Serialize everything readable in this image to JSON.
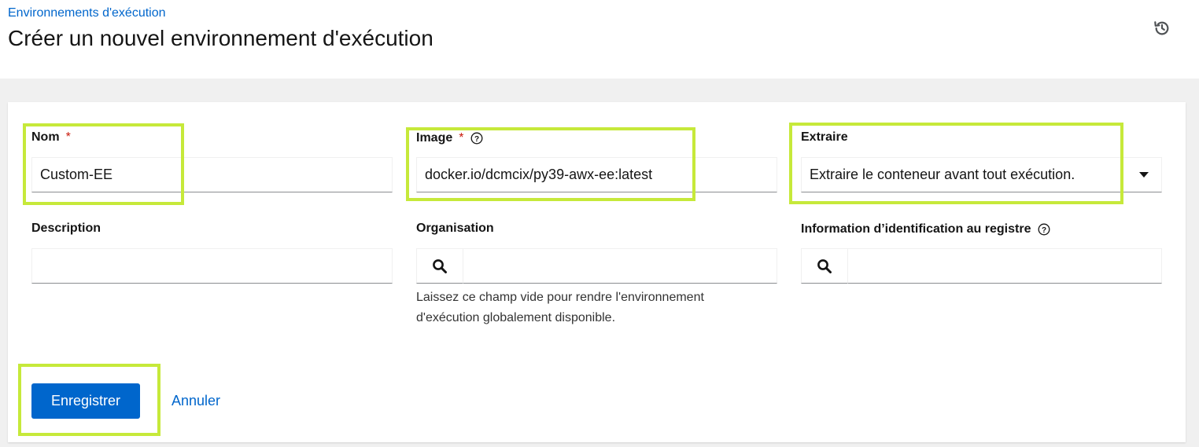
{
  "breadcrumb": {
    "label": "Environnements d'exécution"
  },
  "page": {
    "title": "Créer un nouvel environnement d'exécution"
  },
  "icons": {
    "history": "history-icon",
    "help": "question-circle-icon",
    "search": "search-icon",
    "dropdown": "caret-down-icon"
  },
  "form": {
    "name": {
      "label": "Nom",
      "required_marker": "*",
      "value": "Custom-EE"
    },
    "image": {
      "label": "Image",
      "required_marker": "*",
      "value": "docker.io/dcmcix/py39-awx-ee:latest"
    },
    "pull": {
      "label": "Extraire",
      "value": "Extraire le conteneur avant tout exécution."
    },
    "description": {
      "label": "Description",
      "value": ""
    },
    "organization": {
      "label": "Organisation",
      "value": "",
      "helper": "Laissez ce champ vide pour rendre l'environnement d'exécution globalement disponible."
    },
    "registry_credential": {
      "label": "Information d’identification au registre",
      "value": ""
    }
  },
  "actions": {
    "save_label": "Enregistrer",
    "cancel_label": "Annuler"
  },
  "colors": {
    "primary": "#0066cc",
    "required": "#c9190b",
    "highlight": "#c6e93a"
  }
}
